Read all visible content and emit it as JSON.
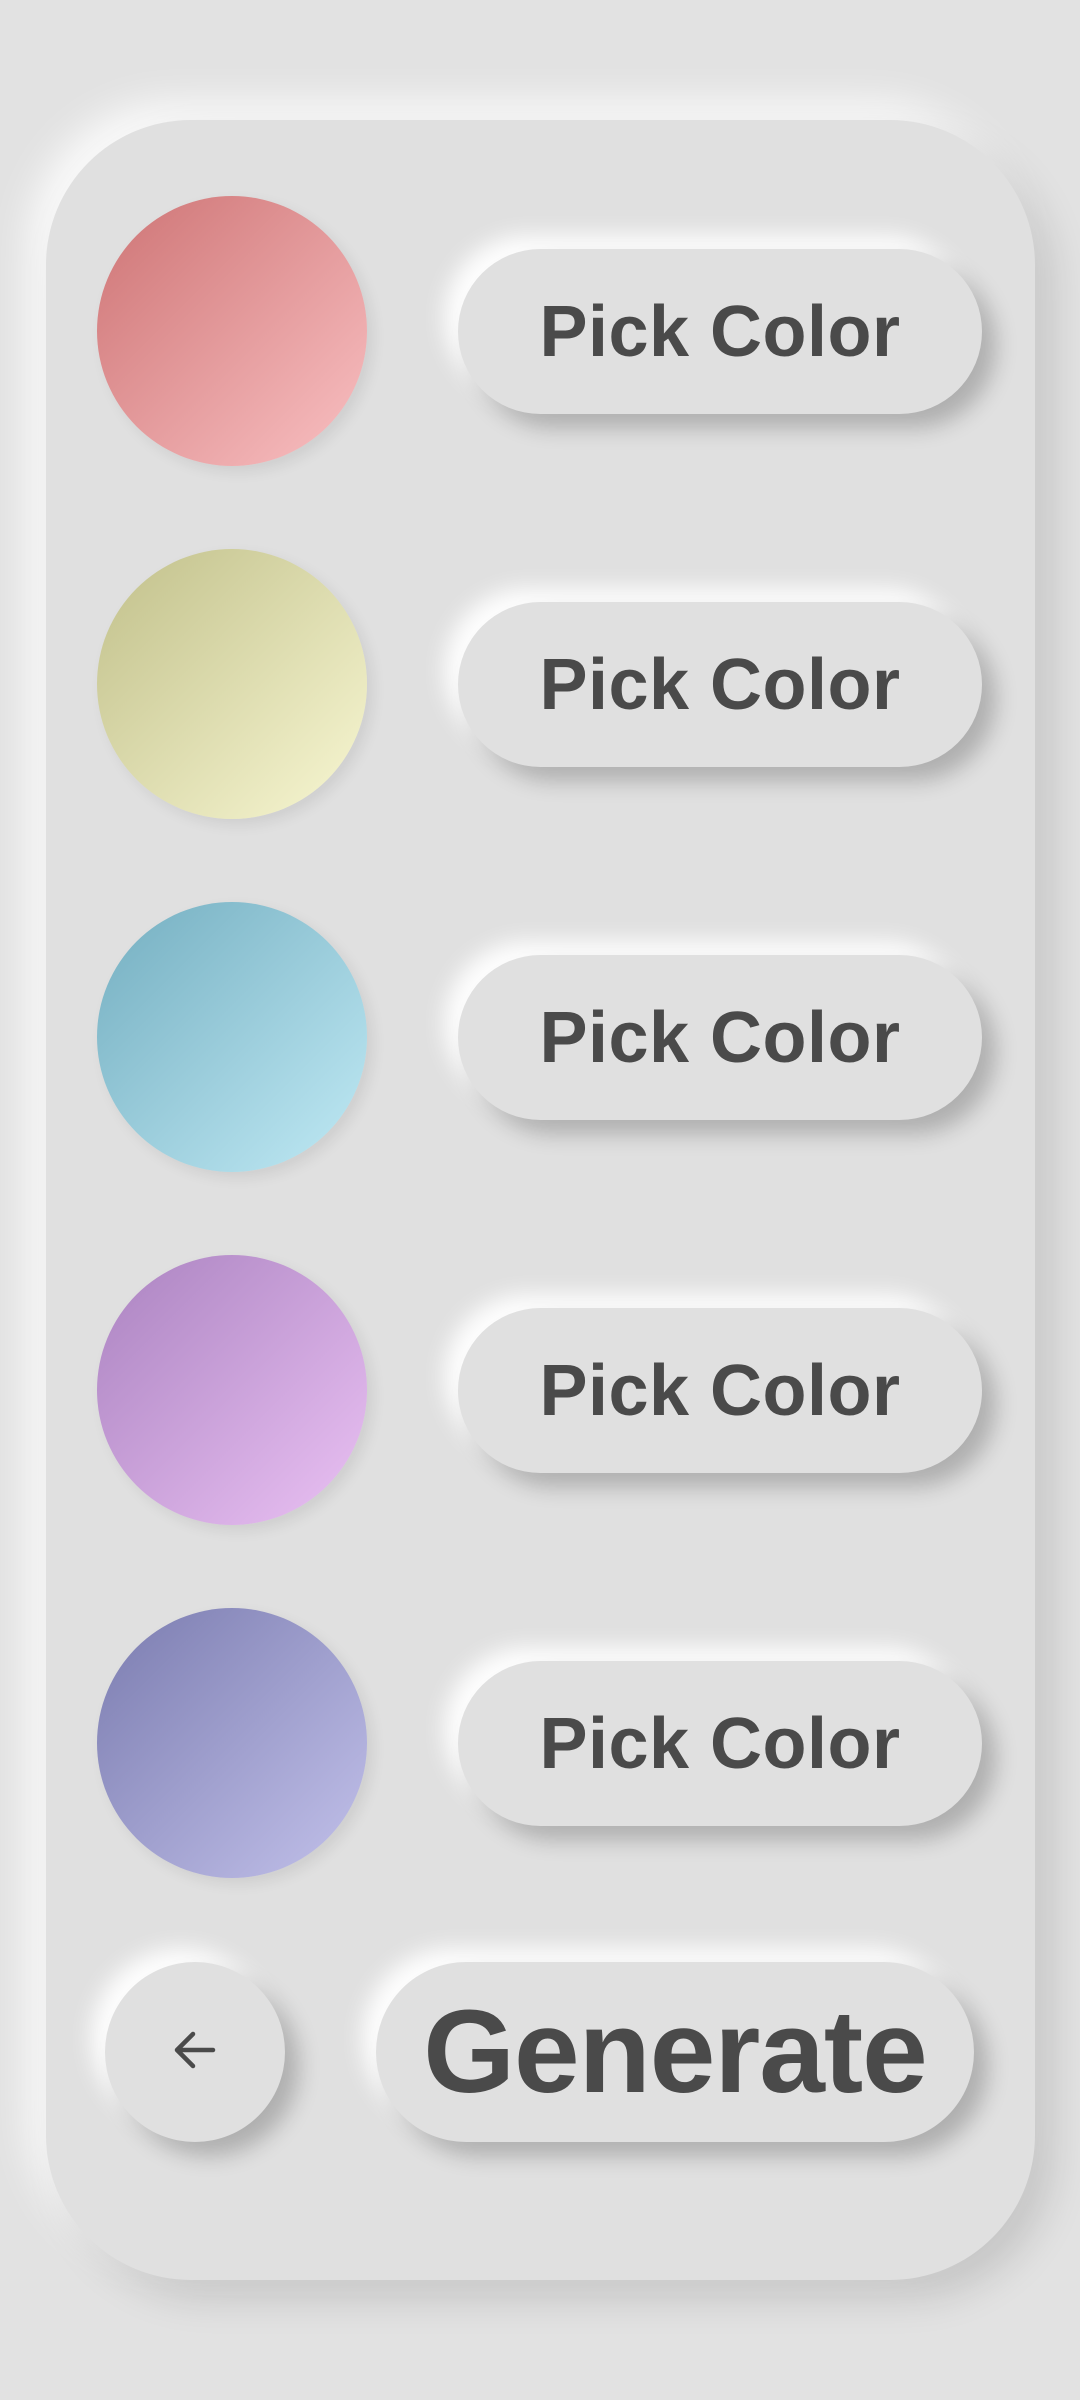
{
  "colors": [
    {
      "label": "Pick Color",
      "swatch_from": "#d47f80",
      "swatch_to": "#f3b5b7"
    },
    {
      "label": "Pick Color",
      "swatch_from": "#c9c895",
      "swatch_to": "#f0efc8"
    },
    {
      "label": "Pick Color",
      "swatch_from": "#7fb7c8",
      "swatch_to": "#b5e1ed"
    },
    {
      "label": "Pick Color",
      "swatch_from": "#b48cc8",
      "swatch_to": "#e1b8ec"
    },
    {
      "label": "Pick Color",
      "swatch_from": "#8586b8",
      "swatch_to": "#b8b7e2"
    }
  ],
  "actions": {
    "back_icon": "arrow-left-icon",
    "generate_label": "Generate"
  }
}
